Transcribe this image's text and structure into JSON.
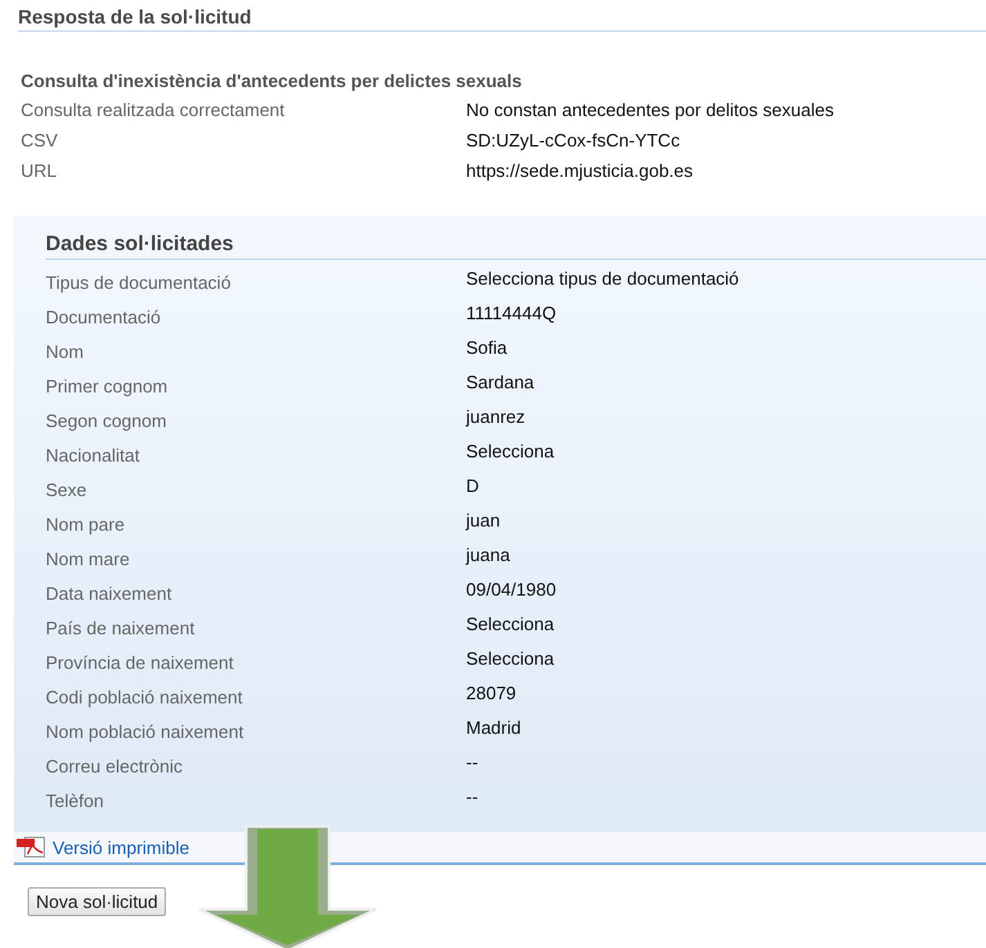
{
  "title": "Resposta de la sol·licitud",
  "result": {
    "heading": "Consulta d'inexistència d'antecedents per delictes sexuals",
    "rows": [
      {
        "label": "Consulta realitzada correctament",
        "value": "No constan antecedentes por delitos sexuales"
      },
      {
        "label": "CSV",
        "value": "SD:UZyL-cCox-fsCn-YTCc"
      },
      {
        "label": "URL",
        "value": "https://sede.mjusticia.gob.es"
      }
    ]
  },
  "requested_data": {
    "heading": "Dades sol·licitades",
    "rows": [
      {
        "label": "Tipus de documentació",
        "value": "Selecciona tipus de documentació"
      },
      {
        "label": "Documentació",
        "value": "11114444Q"
      },
      {
        "label": "Nom",
        "value": "Sofia"
      },
      {
        "label": "Primer cognom",
        "value": "Sardana"
      },
      {
        "label": "Segon cognom",
        "value": "juanrez"
      },
      {
        "label": "Nacionalitat",
        "value": "Selecciona"
      },
      {
        "label": "Sexe",
        "value": "D"
      },
      {
        "label": "Nom pare",
        "value": "juan"
      },
      {
        "label": "Nom mare",
        "value": "juana"
      },
      {
        "label": "Data naixement",
        "value": "09/04/1980"
      },
      {
        "label": "País de naixement",
        "value": "Selecciona"
      },
      {
        "label": "Província de naixement",
        "value": "Selecciona"
      },
      {
        "label": "Codi població naixement",
        "value": "28079"
      },
      {
        "label": "Nom població naixement",
        "value": "Madrid"
      },
      {
        "label": "Correu electrònic",
        "value": "--"
      },
      {
        "label": "Telèfon",
        "value": "--"
      }
    ],
    "print_link": "Versió imprimible"
  },
  "new_request_button": "Nova sol·licitud"
}
